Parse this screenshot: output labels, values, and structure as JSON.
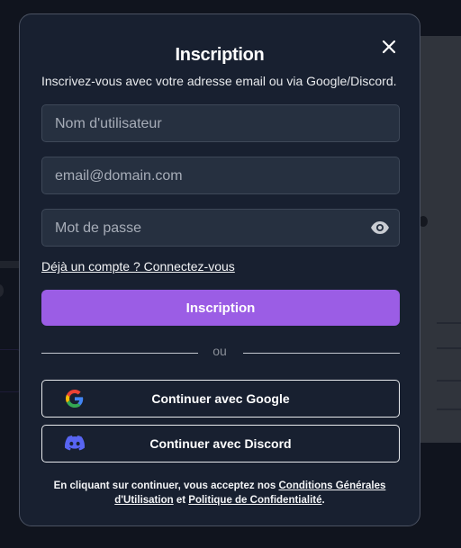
{
  "modal": {
    "title": "Inscription",
    "subtitle": "Inscrivez-vous avec votre adresse email ou via Google/Discord."
  },
  "form": {
    "username_placeholder": "Nom d'utilisateur",
    "email_placeholder": "email@domain.com",
    "password_placeholder": "Mot de passe",
    "login_link": "Déjà un compte ? Connectez-vous",
    "submit_label": "Inscription"
  },
  "divider": {
    "text": "ou"
  },
  "oauth": {
    "google_label": "Continuer avec Google",
    "discord_label": "Continuer avec Discord"
  },
  "legal": {
    "prefix": "En cliquant sur continuer, vous acceptez nos",
    "terms": "Conditions Générales d'Utilisation",
    "and": "et",
    "privacy": "Politique de Confidentialité",
    "suffix": "."
  },
  "icons": {
    "close": "close-icon",
    "eye": "eye-icon",
    "google": "google-icon",
    "discord": "discord-icon"
  },
  "colors": {
    "accent": "#9b5de5",
    "modal_bg": "#182030",
    "input_bg": "#263040",
    "discord": "#5865f2"
  }
}
